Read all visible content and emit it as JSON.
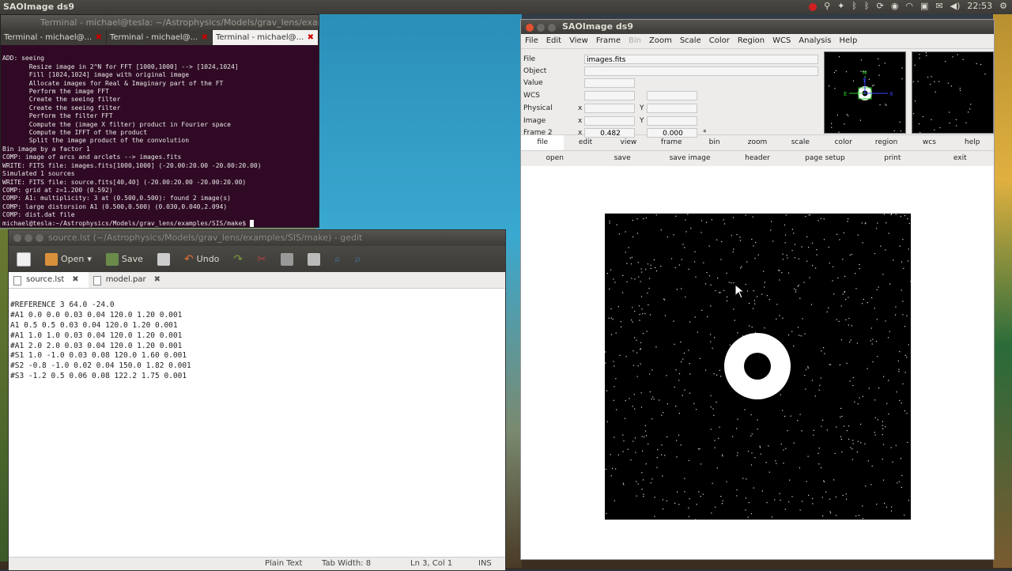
{
  "panel": {
    "app_title": "SAOImage ds9",
    "time": "22:53"
  },
  "terminal": {
    "title": "Terminal - michael@tesla: ~/Astrophysics/Models/grav_lens/exampl",
    "tabs": [
      {
        "label": "Terminal - michael@..."
      },
      {
        "label": "Terminal - michael@..."
      },
      {
        "label": "Terminal - michael@..."
      }
    ],
    "lines": [
      "ADD: seeing",
      "       Resize image in 2^N for FFT [1000,1000] --> [1024,1024]",
      "       Fill [1024,1024] image with original image",
      "       Allocate images for Real & Imaginary part of the FT",
      "       Perform the image FFT",
      "       Create the seeing filter",
      "       Create the seeing filter",
      "       Perform the filter FFT",
      "       Compute the (image X filter) product in Fourier space",
      "       Compute the IFFT of the product",
      "       Split the image product of the convolution",
      "Bin image by a factor 1",
      "COMP: image of arcs and arclets --> images.fits",
      "WRITE: FITS file: images.fits[1000,1000] (-20.00:20.00 -20.00:20.00)",
      "Simulated 1 sources",
      "WRITE: FITS file: source.fits[40,40] (-20.00:20.00 -20.00:20.00)",
      "COMP: grid at z=1.200 (0.592)",
      "COMP: A1: multiplicity: 3 at (0.500,0.500): found 2 image(s)",
      "COMP: large distorsion A1 (0.500,0.500) (0.030,0.040,2.094)",
      "COMP: dist.dat file",
      "michael@tesla:~/Astrophysics/Models/grav_lens/examples/SIS/make$ "
    ]
  },
  "gedit": {
    "title": "source.lst (~/Astrophysics/Models/grav_lens/examples/SIS/make) - gedit",
    "toolbar": {
      "open": "Open",
      "save": "Save",
      "undo": "Undo"
    },
    "tabs": [
      {
        "label": "source.lst"
      },
      {
        "label": "model.par"
      }
    ],
    "lines": [
      "#REFERENCE 3 64.0 -24.0",
      "#A1 0.0 0.0 0.03 0.04 120.0 1.20 0.001",
      "A1 0.5 0.5 0.03 0.04 120.0 1.20 0.001",
      "#A1 1.0 1.0 0.03 0.04 120.0 1.20 0.001",
      "#A1 2.0 2.0 0.03 0.04 120.0 1.20 0.001",
      "#S1 1.0 -1.0 0.03 0.08 120.0 1.60 0.001",
      "#S2 -0.8 -1.0 0.02 0.04 150.0 1.82 0.001",
      "#S3 -1.2 0.5 0.06 0.08 122.2 1.75 0.001"
    ],
    "status": {
      "lang": "Plain Text",
      "tab": "Tab Width: 8",
      "pos": "Ln 3, Col 1",
      "mode": "INS"
    }
  },
  "ds9": {
    "title": "SAOImage ds9",
    "menu": [
      "File",
      "Edit",
      "View",
      "Frame",
      "Bin",
      "Zoom",
      "Scale",
      "Color",
      "Region",
      "WCS",
      "Analysis",
      "Help"
    ],
    "info": {
      "file_label": "File",
      "file_value": "images.fits",
      "object_label": "Object",
      "value_label": "Value",
      "wcs_label": "WCS",
      "physical_label": "Physical",
      "image_label": "Image",
      "frame_label": "Frame 2",
      "x": "x",
      "y": "Y",
      "frame_x": "0.482",
      "frame_y": "0.000",
      "star": "*"
    },
    "compass": {
      "n": "N",
      "e": "E",
      "x": "X",
      "y": "Y"
    },
    "buttons1": [
      "file",
      "edit",
      "view",
      "frame",
      "bin",
      "zoom",
      "scale",
      "color",
      "region",
      "wcs",
      "help"
    ],
    "buttons2": [
      "open",
      "save",
      "save image",
      "header",
      "page setup",
      "print",
      "exit"
    ]
  }
}
